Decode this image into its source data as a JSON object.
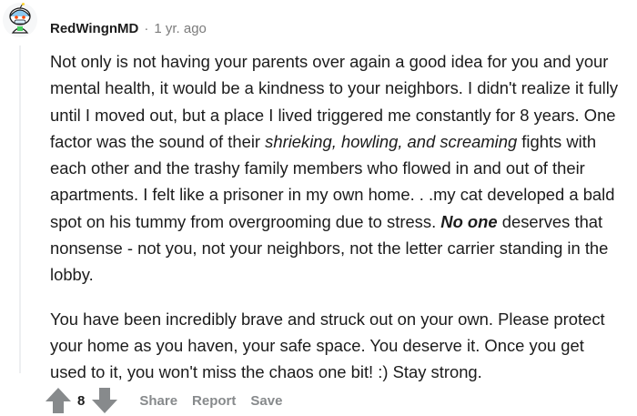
{
  "comment": {
    "username": "RedWingnMD",
    "separator": "·",
    "timestamp": "1 yr. ago",
    "paragraphs": [
      [
        {
          "text": "Not only is not having your parents over again a good idea for you and your mental health, it would be a kindness to your neighbors. I didn't realize it fully until I moved out, but a place I lived triggered me constantly for 8 years. One factor was the sound of their ",
          "style": "normal"
        },
        {
          "text": "shrieking, howling, and screaming",
          "style": "italic"
        },
        {
          "text": " fights with each other and the trashy family members who flowed in and out of their apartments. I felt like a prisoner in my own home. . .my cat developed a bald spot on his tummy from overgrooming due to stress. ",
          "style": "normal"
        },
        {
          "text": "No one",
          "style": "bold-italic"
        },
        {
          "text": " deserves that nonsense - not you, not your neighbors, not the letter carrier standing in the lobby.",
          "style": "normal"
        }
      ],
      [
        {
          "text": "You have been incredibly brave and struck out on your own. Please protect your home as you haven, your safe space. You deserve it. Once you get used to it, you won't miss the chaos one bit! :) Stay strong.",
          "style": "normal"
        }
      ]
    ],
    "vote_score": "8",
    "actions": {
      "share": "Share",
      "report": "Report",
      "save": "Save"
    }
  },
  "icons": {
    "avatar": "snoo-avatar-icon",
    "upvote": "upvote-arrow-icon",
    "downvote": "downvote-arrow-icon"
  },
  "colors": {
    "text": "#1c1c1c",
    "meta": "#7c7c7c",
    "action": "#878a8c",
    "vote_arrow": "#878a8c"
  }
}
